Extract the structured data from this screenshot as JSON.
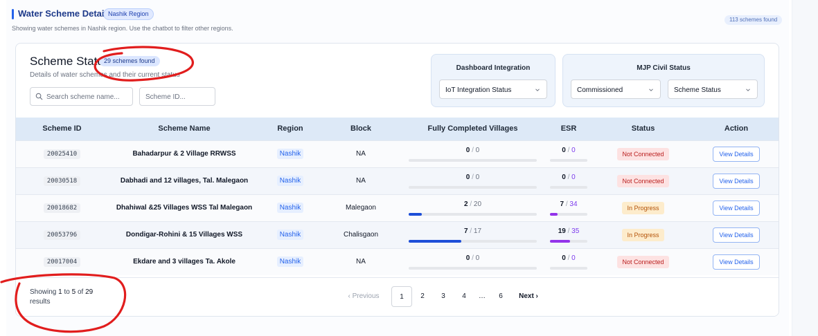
{
  "header": {
    "title": "Water Scheme Details",
    "region_badge": "Nashik Region",
    "subtitle": "Showing water schemes in Nashik region. Use the chatbot to filter other regions.",
    "count_badge": "113 schemes found"
  },
  "card": {
    "title": "Scheme Status",
    "count_badge": "29 schemes found",
    "subtitle": "Details of water schemes and their current status",
    "search_placeholder": "Search scheme name...",
    "scheme_id_placeholder": "Scheme ID..."
  },
  "filters": {
    "dashboard": {
      "title": "Dashboard Integration",
      "select_value": "IoT Integration Status"
    },
    "mjp": {
      "title": "MJP Civil Status",
      "select1_value": "Commissioned",
      "select2_value": "Scheme Status"
    }
  },
  "table": {
    "headers": [
      "Scheme ID",
      "Scheme Name",
      "Region",
      "Block",
      "Fully Completed Villages",
      "ESR",
      "Status",
      "Action"
    ],
    "rows": [
      {
        "id": "20025410",
        "name": "Bahadarpur & 2 Village RRWSS",
        "region": "Nashik",
        "block": "NA",
        "villages_done": "0",
        "villages_total": "0",
        "villages_fraction": 0,
        "esr_done": "0",
        "esr_total": "0",
        "esr_fraction": 0,
        "status": "Not Connected",
        "status_kind": "nc",
        "action": "View Details"
      },
      {
        "id": "20030518",
        "name": "Dabhadi and 12 villages, Tal. Malegaon",
        "region": "Nashik",
        "block": "NA",
        "villages_done": "0",
        "villages_total": "0",
        "villages_fraction": 0,
        "esr_done": "0",
        "esr_total": "0",
        "esr_fraction": 0,
        "status": "Not Connected",
        "status_kind": "nc",
        "action": "View Details"
      },
      {
        "id": "20018682",
        "name": "Dhahiwal &25 Villages WSS Tal Malegaon",
        "region": "Nashik",
        "block": "Malegaon",
        "villages_done": "2",
        "villages_total": "20",
        "villages_fraction": 0.1,
        "esr_done": "7",
        "esr_total": "34",
        "esr_fraction": 0.206,
        "status": "In Progress",
        "status_kind": "ip",
        "action": "View Details"
      },
      {
        "id": "20053796",
        "name": "Dondigar-Rohini & 15 Villages WSS",
        "region": "Nashik",
        "block": "Chalisgaon",
        "villages_done": "7",
        "villages_total": "17",
        "villages_fraction": 0.412,
        "esr_done": "19",
        "esr_total": "35",
        "esr_fraction": 0.543,
        "status": "In Progress",
        "status_kind": "ip",
        "action": "View Details"
      },
      {
        "id": "20017004",
        "name": "Ekdare and 3 villages Ta. Akole",
        "region": "Nashik",
        "block": "NA",
        "villages_done": "0",
        "villages_total": "0",
        "villages_fraction": 0,
        "esr_done": "0",
        "esr_total": "0",
        "esr_fraction": 0,
        "status": "Not Connected",
        "status_kind": "nc",
        "action": "View Details"
      }
    ]
  },
  "pagination": {
    "showing_prefix": "Showing",
    "from": "1",
    "to_word": "to",
    "to": "5",
    "of_word": "of",
    "total": "29",
    "suffix": "results",
    "prev_label": "‹ Previous",
    "next_label": "Next ›",
    "pages": [
      "1",
      "2",
      "3",
      "4",
      "…",
      "6"
    ],
    "current": "1"
  },
  "colors": {
    "accent": "#2563eb",
    "annotation": "#e11d1d"
  }
}
